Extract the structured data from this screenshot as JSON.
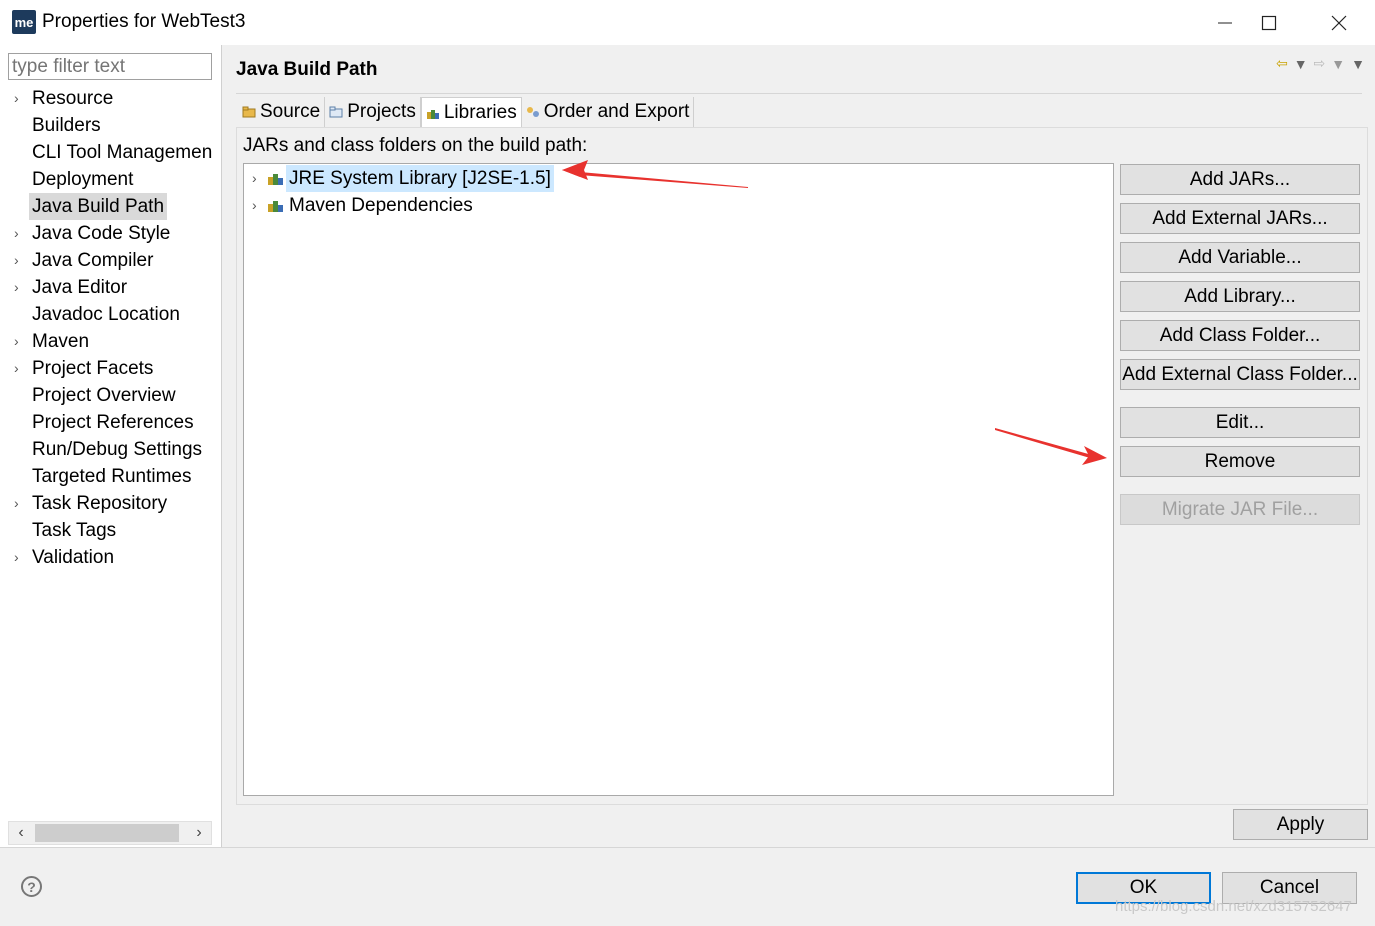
{
  "window": {
    "logo_text": "me",
    "title": "Properties for WebTest3"
  },
  "sidebar": {
    "filter_placeholder": "type filter text",
    "items": [
      {
        "label": "Resource",
        "expandable": true
      },
      {
        "label": "Builders",
        "expandable": false
      },
      {
        "label": "CLI Tool Managemen",
        "expandable": false
      },
      {
        "label": "Deployment",
        "expandable": false
      },
      {
        "label": "Java Build Path",
        "expandable": false,
        "selected": true
      },
      {
        "label": "Java Code Style",
        "expandable": true
      },
      {
        "label": "Java Compiler",
        "expandable": true
      },
      {
        "label": "Java Editor",
        "expandable": true
      },
      {
        "label": "Javadoc Location",
        "expandable": false
      },
      {
        "label": "Maven",
        "expandable": true
      },
      {
        "label": "Project Facets",
        "expandable": true
      },
      {
        "label": "Project Overview",
        "expandable": false
      },
      {
        "label": "Project References",
        "expandable": false
      },
      {
        "label": "Run/Debug Settings",
        "expandable": false
      },
      {
        "label": "Targeted Runtimes",
        "expandable": false
      },
      {
        "label": "Task Repository",
        "expandable": true
      },
      {
        "label": "Task Tags",
        "expandable": false
      },
      {
        "label": "Validation",
        "expandable": true
      }
    ]
  },
  "main": {
    "title": "Java Build Path",
    "tabs": [
      {
        "label": "Source",
        "icon": "source-folder-icon"
      },
      {
        "label": "Projects",
        "icon": "projects-icon"
      },
      {
        "label": "Libraries",
        "icon": "libraries-icon",
        "active": true
      },
      {
        "label": "Order and Export",
        "icon": "order-export-icon"
      }
    ],
    "description": "JARs and class folders on the build path:",
    "libraries": [
      {
        "label": "JRE System Library [J2SE-1.5]",
        "selected": true
      },
      {
        "label": "Maven Dependencies",
        "selected": false
      }
    ],
    "buttons": {
      "add_jars": "Add JARs...",
      "add_external_jars": "Add External JARs...",
      "add_variable": "Add Variable...",
      "add_library": "Add Library...",
      "add_class_folder": "Add Class Folder...",
      "add_external_class_folder": "Add External Class Folder...",
      "edit": "Edit...",
      "remove": "Remove",
      "migrate_jar": "Migrate JAR File..."
    },
    "apply": "Apply"
  },
  "footer": {
    "ok": "OK",
    "cancel": "Cancel",
    "watermark": "https://blog.csdn.net/xzd315752647"
  },
  "colors": {
    "selection": "#cce8ff",
    "sidebar_selection": "#d9d9d9",
    "default_button_border": "#0078d7",
    "annotation_arrow": "#e8322e"
  }
}
